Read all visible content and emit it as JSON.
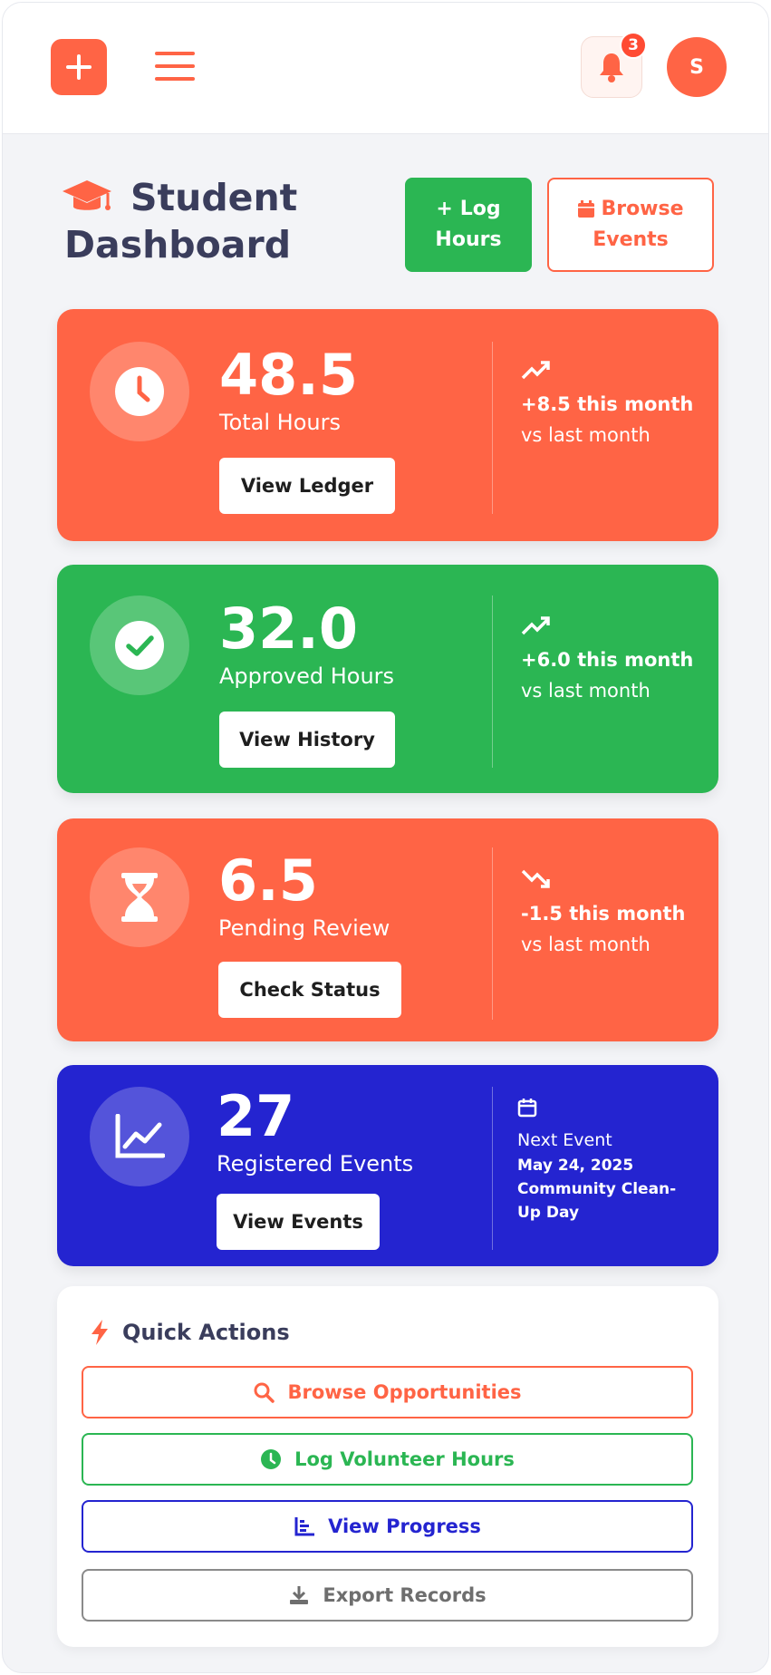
{
  "colors": {
    "brand": "#FF6445",
    "green": "#2BB653",
    "blue": "#2424D0",
    "gray": "#6E6E6E",
    "text": "#3A3D5C"
  },
  "header": {
    "logo_icon": "plus-icon",
    "menu_icon": "hamburger-icon",
    "notifications": {
      "icon": "bell-icon",
      "count": "3"
    },
    "avatar_initial": "S"
  },
  "page": {
    "title_line1": "Student",
    "title_line2": "Dashboard",
    "title_icon": "graduation-cap-icon",
    "actions": {
      "log_hours": {
        "prefix": "+",
        "line1": "Log",
        "line2": "Hours"
      },
      "browse_events": {
        "icon": "calendar-icon",
        "line1": "Browse",
        "line2": "Events"
      }
    }
  },
  "cards": {
    "total": {
      "value": "48.5",
      "label": "Total Hours",
      "button": "View Ledger",
      "icon": "clock-icon",
      "delta": "+8.5 this month",
      "sub": "vs last month",
      "trend": "trending-up-icon"
    },
    "approved": {
      "value": "32.0",
      "label": "Approved Hours",
      "button": "View History",
      "icon": "check-circle-icon",
      "delta": "+6.0 this month",
      "sub": "vs last month",
      "trend": "trending-up-icon"
    },
    "pending": {
      "value": "6.5",
      "label": "Pending Review",
      "button": "Check Status",
      "icon": "hourglass-icon",
      "delta": "-1.5 this month",
      "sub": "vs last month",
      "trend": "trending-down-icon"
    },
    "events": {
      "value": "27",
      "label": "Registered Events",
      "button": "View Events",
      "icon": "chart-line-icon",
      "next_label": "Next Event",
      "next_date": "May 24, 2025",
      "next_name": "Community Clean-Up Day"
    }
  },
  "quick_actions": {
    "title": "Quick Actions",
    "icon": "bolt-icon",
    "items": [
      {
        "label": "Browse Opportunities",
        "icon": "search-icon"
      },
      {
        "label": "Log Volunteer Hours",
        "icon": "clock-icon"
      },
      {
        "label": "View Progress",
        "icon": "bar-chart-icon"
      },
      {
        "label": "Export Records",
        "icon": "download-icon"
      }
    ]
  }
}
